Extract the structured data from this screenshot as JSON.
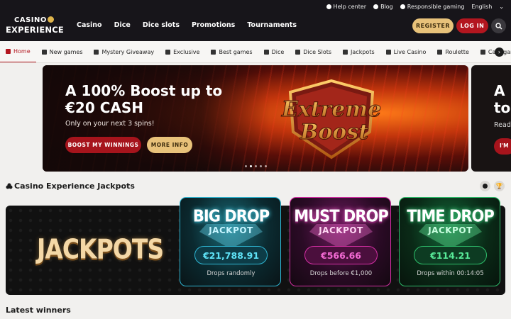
{
  "logo": {
    "line1": "CASINO",
    "line2": "EXPERIENCE"
  },
  "utility": {
    "help": "Help center",
    "blog": "Blog",
    "responsible": "Responsible gaming",
    "language": "English"
  },
  "mainnav": [
    "Casino",
    "Dice",
    "Dice slots",
    "Promotions",
    "Tournaments"
  ],
  "auth": {
    "register": "REGISTER",
    "login": "LOG IN"
  },
  "categories": [
    {
      "label": "Home",
      "active": true
    },
    {
      "label": "New games"
    },
    {
      "label": "Mystery Giveaway"
    },
    {
      "label": "Exclusive"
    },
    {
      "label": "Best games"
    },
    {
      "label": "Dice"
    },
    {
      "label": "Dice Slots"
    },
    {
      "label": "Jackpots"
    },
    {
      "label": "Live Casino"
    },
    {
      "label": "Roulette"
    },
    {
      "label": "Card games"
    }
  ],
  "hero": {
    "title": "A 100% Boost up to €20 CASH",
    "subtitle": "Only on your next 3 spins!",
    "primary": "BOOST MY WINNINGS",
    "secondary": "MORE INFO",
    "badge_line1": "Extreme",
    "badge_line2": "Boost"
  },
  "hero_next": {
    "title": "A to",
    "subtitle": "Read",
    "button": "I'M"
  },
  "jackpots": {
    "section_title": "Casino Experience Jackpots",
    "banner": "JACKPOTS",
    "cards": [
      {
        "line1": "BIG DROP",
        "line2": "JACKPOT",
        "amount": "€21,788.91",
        "desc": "Drops randomly"
      },
      {
        "line1": "MUST DROP",
        "line2": "JACKPOT",
        "amount": "€566.66",
        "desc": "Drops before €1,000"
      },
      {
        "line1": "TIME DROP",
        "line2": "JACKPOT",
        "amount": "€114.21",
        "desc": "Drops within 00:14:05"
      }
    ]
  },
  "latest": {
    "title": "Latest winners"
  },
  "colors": {
    "brand_red": "#b3161f",
    "gold": "#e8c27a",
    "topbar": "#17151a"
  }
}
